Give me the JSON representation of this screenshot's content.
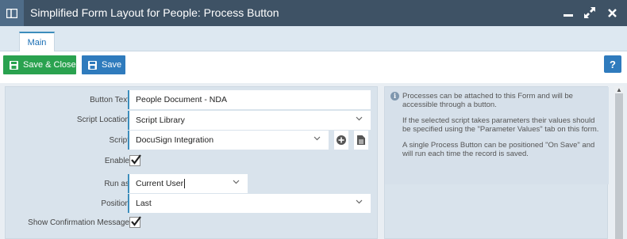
{
  "window": {
    "title": "Simplified Form Layout for People: Process Button"
  },
  "tabs": [
    {
      "label": "Main"
    }
  ],
  "toolbar": {
    "save_close_label": "Save & Close",
    "save_label": "Save",
    "help_label": "?"
  },
  "form": {
    "button_text": {
      "label": "Button Text",
      "value": "People Document - NDA"
    },
    "script_location": {
      "label": "Script Location",
      "value": "Script Library"
    },
    "script": {
      "label": "Script",
      "value": "DocuSign Integration"
    },
    "enable": {
      "label": "Enable",
      "checked": true
    },
    "run_as": {
      "label": "Run as",
      "value": "Current User"
    },
    "position": {
      "label": "Position",
      "value": "Last"
    },
    "show_confirmation": {
      "label": "Show Confirmation Message",
      "checked": true
    }
  },
  "info": {
    "icon": "info-icon",
    "paragraphs": [
      "Processes can be attached to this Form and will be accessible through a button.",
      "If the selected script takes parameters their values should be specified using the \"Parameter Values\" tab on this form.",
      "A single Process Button can be positioned \"On Save\" and will run each time the record is saved."
    ]
  },
  "colors": {
    "titlebar": "#3e5265",
    "accent": "#3c8dbc",
    "save_close": "#2aa24f",
    "save": "#2f7bbd"
  }
}
